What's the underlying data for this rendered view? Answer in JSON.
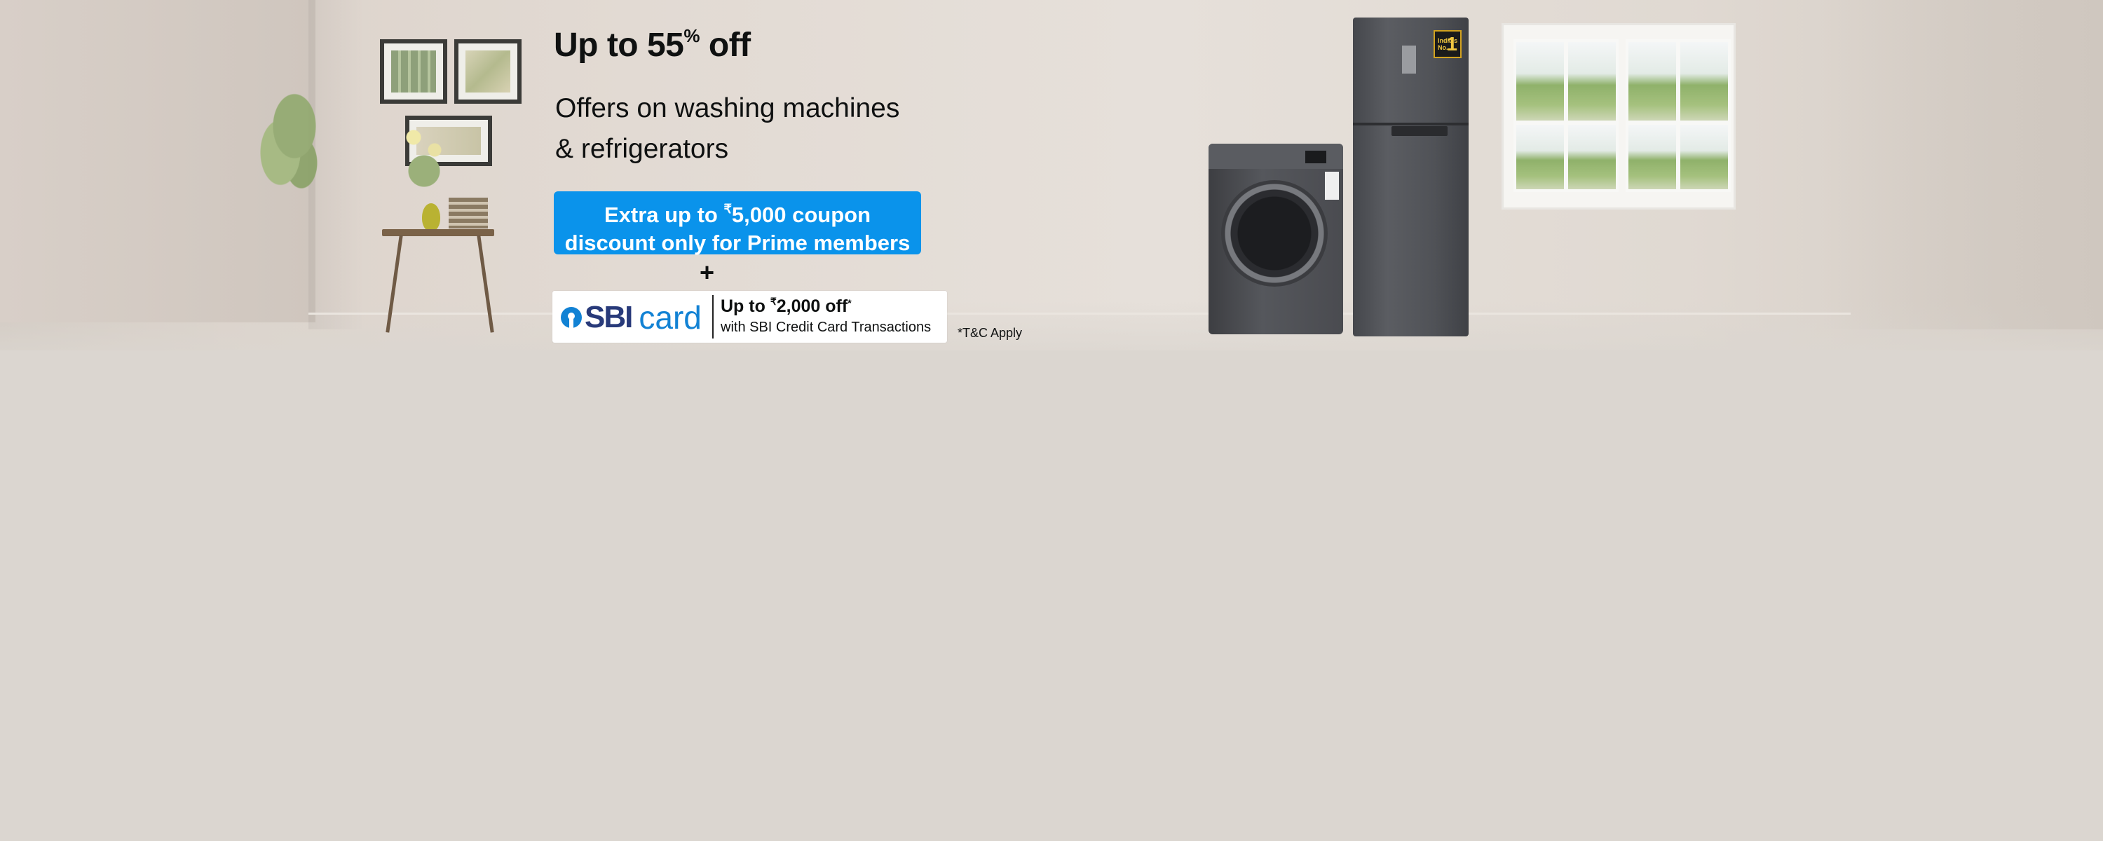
{
  "banner": {
    "headline_prefix": "Up to 55",
    "headline_percent": "%",
    "headline_suffix": " off",
    "subline_line1": "Offers on washing machines",
    "subline_line2": "& refrigerators",
    "prime_line1_prefix": "Extra up to ",
    "prime_rupee": "₹",
    "prime_line1_suffix": "5,000 coupon",
    "prime_line2": "discount only for Prime members",
    "plus": "+",
    "sbi_logo_text": "SBI",
    "sbi_logo_card": "card",
    "sbi_offer_prefix": "Up to ",
    "sbi_offer_rupee": "₹",
    "sbi_offer_amount": "2,000 off",
    "sbi_offer_star": "*",
    "sbi_offer_sub": "with SBI Credit Card Transactions",
    "tnc": "*T&C Apply",
    "fridge_badge_text": "India's No.",
    "fridge_badge_number": "1"
  },
  "colors": {
    "prime_blue": "#0a93eb",
    "sbi_navy": "#283a7a",
    "sbi_blue": "#1282d4",
    "text_dark": "#0f1111",
    "background": "#dbd6d0"
  },
  "icons": {
    "sbi_mark": "sbi-logo-icon"
  }
}
